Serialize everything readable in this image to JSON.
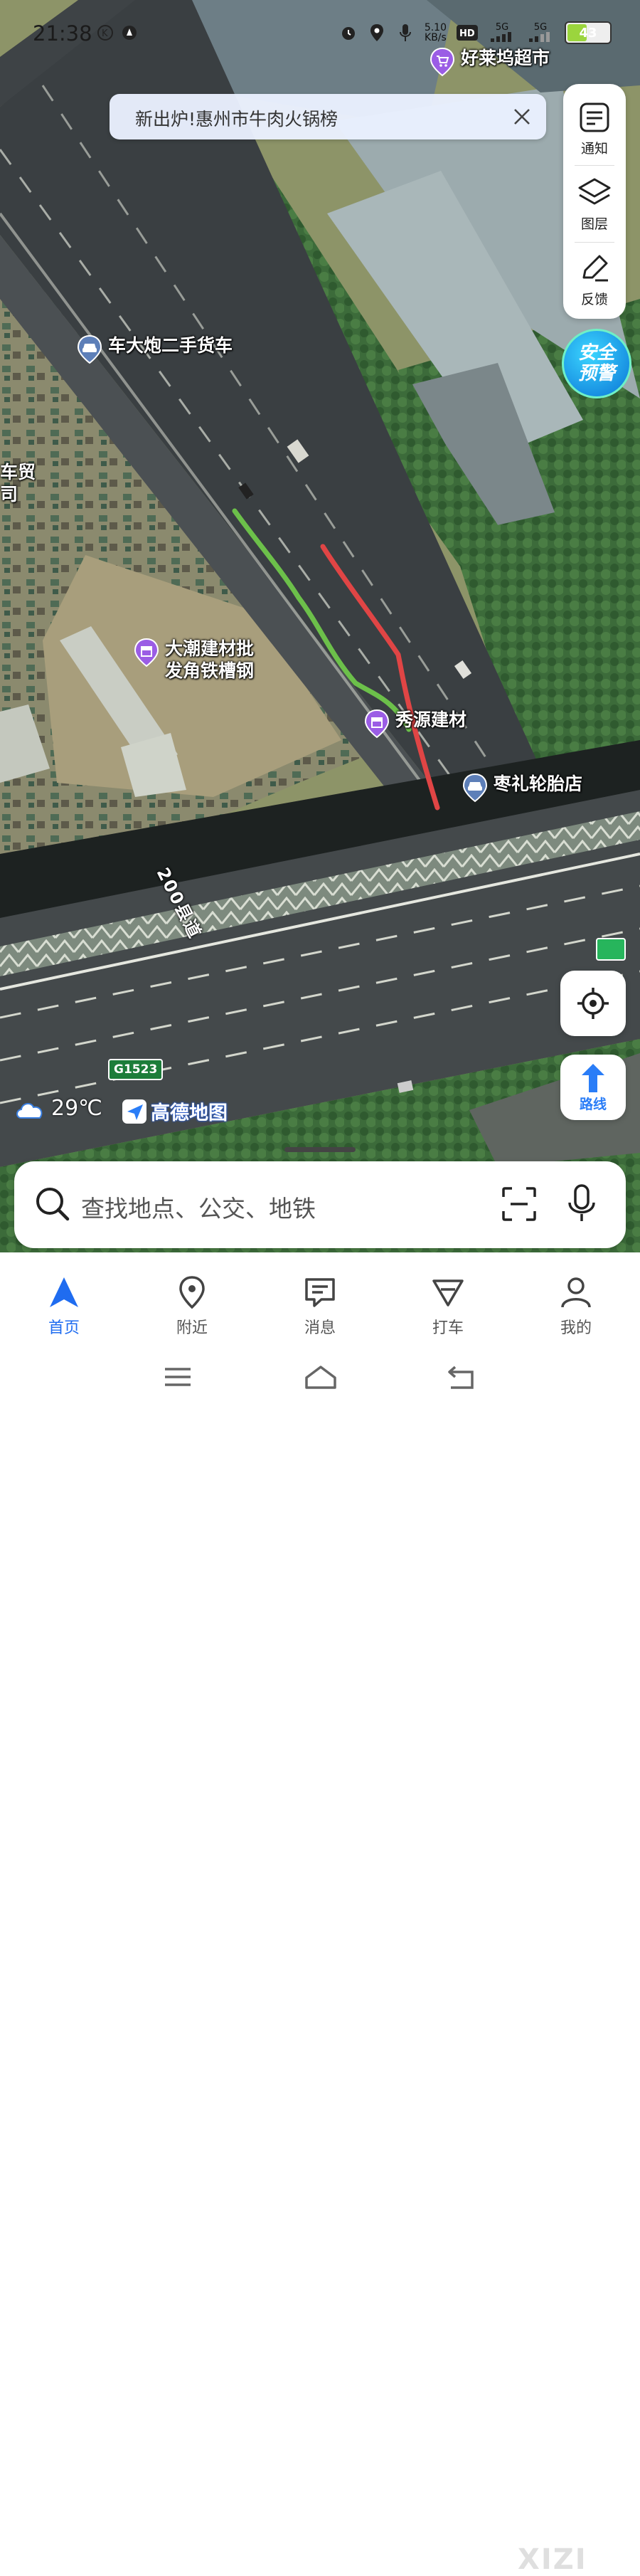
{
  "status_bar": {
    "time": "21:38",
    "net_speed_value": "5.10",
    "net_speed_unit": "KB/s",
    "battery": "43",
    "battery_level": 0.43,
    "signal_label_1": "5G",
    "signal_label_2": "5G"
  },
  "banner": {
    "text": "新出炉!惠州市牛肉火锅榜"
  },
  "map": {
    "pois": [
      {
        "name": "好莱坞超市",
        "icon": "shopping-cart-icon"
      },
      {
        "name": "车大炮二手货车",
        "icon": "car-icon"
      },
      {
        "name": "车贸\n司",
        "icon": ""
      },
      {
        "name": "大潮建材批\n发角铁槽钢",
        "icon": "store-icon"
      },
      {
        "name": "秀源建材",
        "icon": "store-icon"
      },
      {
        "name": "枣礼轮胎店",
        "icon": "car-icon"
      }
    ],
    "road_name": "200县道",
    "highway_shield": "G1523",
    "drawn_lines": [
      {
        "color": "#6cc04a"
      },
      {
        "color": "#e04545"
      }
    ]
  },
  "right_panel": {
    "notify": "通知",
    "layers": "图层",
    "feedback": "反馈"
  },
  "safety_alert": {
    "line1": "安全",
    "line2": "预警"
  },
  "route_button": {
    "label": "路线"
  },
  "weather": {
    "temp": "29℃",
    "icon": "cloud-icon"
  },
  "logo": {
    "text": "高德地图"
  },
  "search": {
    "placeholder": "查找地点、公交、地铁"
  },
  "tabs": [
    {
      "label": "首页",
      "active": true
    },
    {
      "label": "附近",
      "active": false
    },
    {
      "label": "消息",
      "active": false
    },
    {
      "label": "打车",
      "active": false
    },
    {
      "label": "我的",
      "active": false
    }
  ],
  "watermark": "XIZI",
  "colors": {
    "accent": "#1f6cf0",
    "poi_purple": "#9b5de5"
  }
}
